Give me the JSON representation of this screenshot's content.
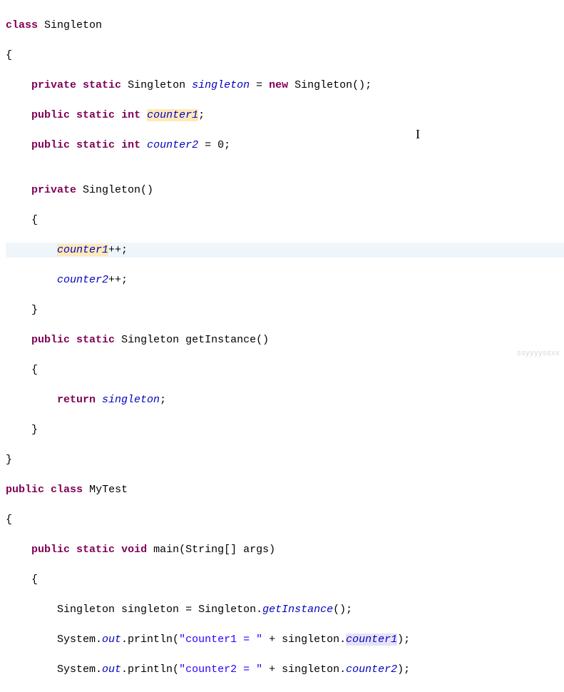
{
  "code": {
    "l1": {
      "kw1": "class",
      "name": "Singleton"
    },
    "l2": {
      "brace": "{"
    },
    "l3": {
      "kw1": "private",
      "kw2": "static",
      "type": "Singleton",
      "field": "singleton",
      "eq": " = ",
      "kw3": "new",
      "ctor": "Singleton();"
    },
    "l4": {
      "kw1": "public",
      "kw2": "static",
      "kw3": "int",
      "field": "counter1",
      "tail": ";"
    },
    "l5": {
      "kw1": "public",
      "kw2": "static",
      "kw3": "int",
      "field": "counter2",
      "tail": " = 0;"
    },
    "l6": {
      "blank": ""
    },
    "l7": {
      "kw1": "private",
      "ctor": "Singleton()"
    },
    "l8": {
      "brace": "{"
    },
    "l9": {
      "field": "counter1",
      "op": "++;"
    },
    "l10": {
      "field": "counter2",
      "op": "++;"
    },
    "l11": {
      "brace": "}"
    },
    "l12": {
      "kw1": "public",
      "kw2": "static",
      "type": "Singleton",
      "method": "getInstance()"
    },
    "l13": {
      "brace": "{"
    },
    "l14": {
      "kw1": "return",
      "field": "singleton",
      "tail": ";"
    },
    "l15": {
      "brace": "}"
    },
    "l16": {
      "brace": "}"
    },
    "l17": {
      "kw1": "public",
      "kw2": "class",
      "name": "MyTest"
    },
    "l18": {
      "brace": "{"
    },
    "l19": {
      "kw1": "public",
      "kw2": "static",
      "kw3": "void",
      "method": "main(String[] args)"
    },
    "l20": {
      "brace": "{"
    },
    "l21": {
      "type": "Singleton",
      "var": "singleton",
      "eq": " = Singleton.",
      "method": "getInstance",
      "tail": "();"
    },
    "l22": {
      "cls": "System.",
      "out": "out",
      "mid": ".println(",
      "str": "\"counter1 = \"",
      "plus": " + singleton.",
      "field": "counter1",
      "tail": ");"
    },
    "l23": {
      "cls": "System.",
      "out": "out",
      "mid": ".println(",
      "str": "\"counter2 = \"",
      "plus": " + singleton.",
      "field": "counter2",
      "tail": ");"
    }
  },
  "watermark": "ssyyyyssxx"
}
